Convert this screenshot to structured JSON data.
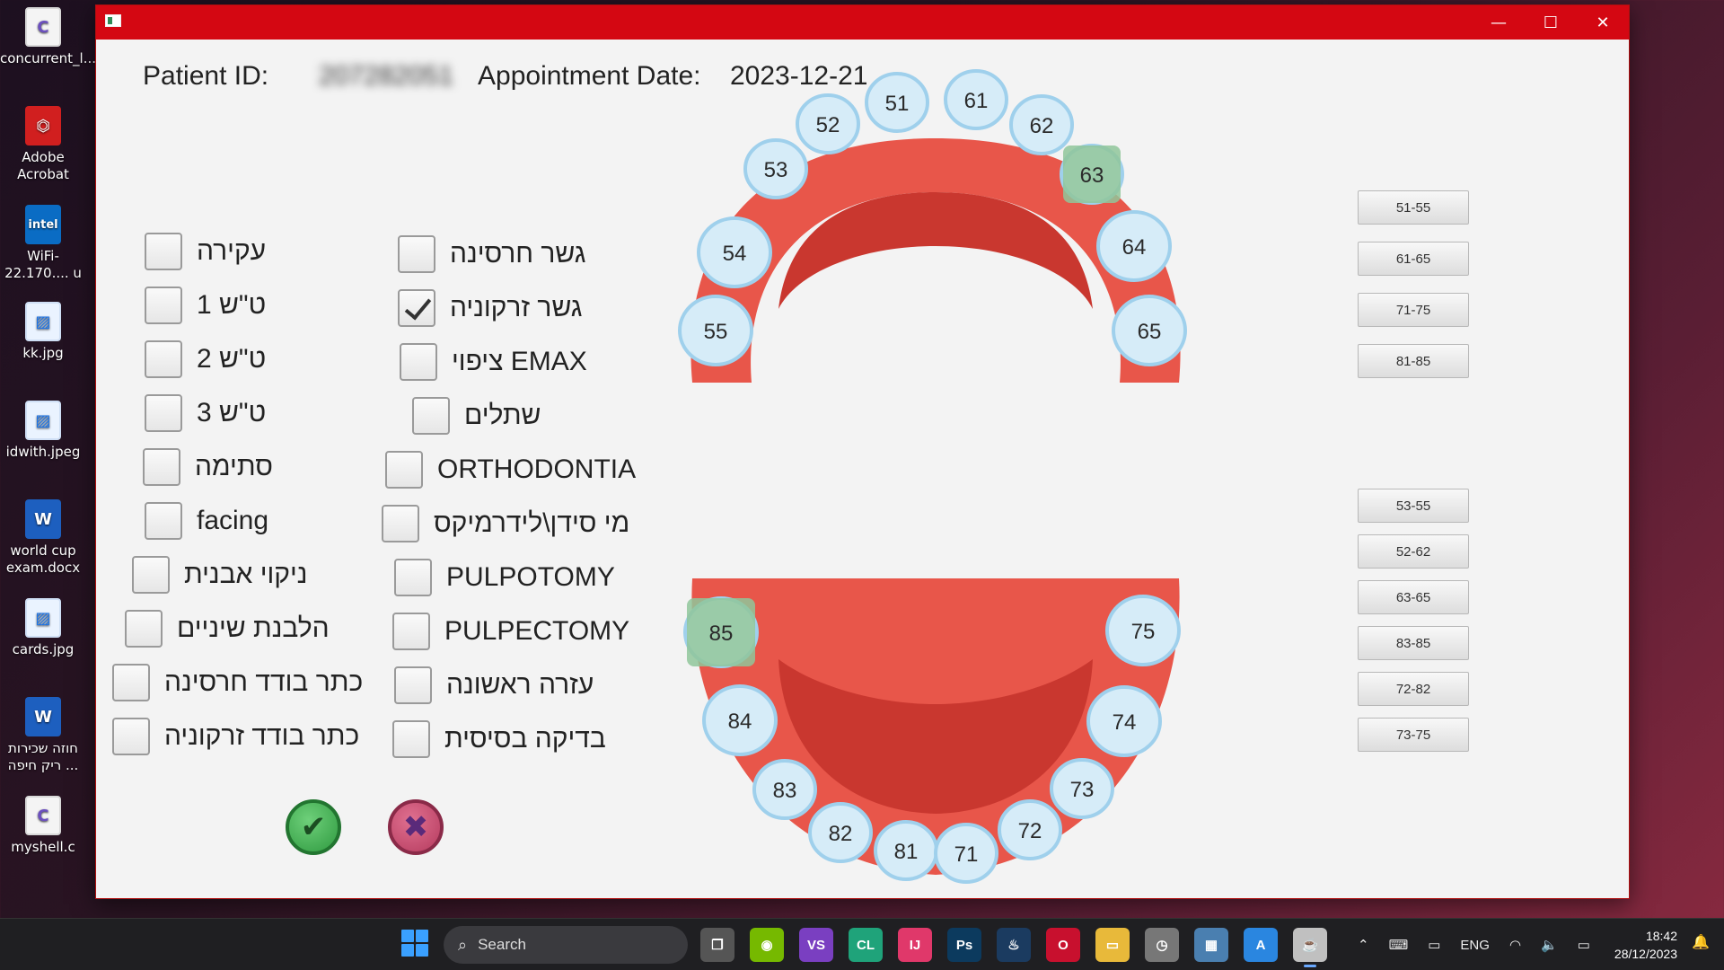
{
  "desktop": {
    "icons": [
      {
        "label": "concurrent_l...",
        "icon": "c-file-icon",
        "glyph": "C"
      },
      {
        "label": "Adobe Acrobat",
        "icon": "pdf-icon",
        "glyph": "⏣"
      },
      {
        "label": "WiFi-22.170.... u",
        "icon": "intel-icon",
        "glyph": "intel"
      },
      {
        "label": "kk.jpg",
        "icon": "image-icon",
        "glyph": "▨"
      },
      {
        "label": "idwith.jpeg",
        "icon": "image-icon",
        "glyph": "▨"
      },
      {
        "label": "world cup exam.docx",
        "icon": "word-icon",
        "glyph": "W"
      },
      {
        "label": "cards.jpg",
        "icon": "image-icon",
        "glyph": "▨"
      },
      {
        "label": "חוזה שכירות ריק חיפה ...",
        "icon": "word-icon",
        "glyph": "W"
      },
      {
        "label": "myshell.c",
        "icon": "c-file-icon",
        "glyph": "C"
      }
    ]
  },
  "window": {
    "controls": {
      "minimize": "—",
      "maximize": "☐",
      "close": "✕"
    },
    "header": {
      "patient_id_label": "Patient ID:",
      "patient_id_value": "207282051",
      "appointment_label": "Appointment Date:",
      "appointment_value": "2023-12-21"
    },
    "treatments_left": [
      {
        "label": "עקירה",
        "checked": false
      },
      {
        "label": "ט\"ש 1",
        "checked": false
      },
      {
        "label": "ט\"ש 2",
        "checked": false
      },
      {
        "label": "ט\"ש 3",
        "checked": false
      },
      {
        "label": "סתימה",
        "checked": false
      },
      {
        "label": "facing",
        "checked": false
      },
      {
        "label": "ניקוי אבנית",
        "checked": false
      },
      {
        "label": "הלבנת שיניים",
        "checked": false
      },
      {
        "label": "כתר בודד חרסינה",
        "checked": false
      },
      {
        "label": "כתר בודד זרקוניה",
        "checked": false
      }
    ],
    "treatments_right": [
      {
        "label": "גשר חרסינה",
        "checked": false
      },
      {
        "label": "גשר זרקוניה",
        "checked": true
      },
      {
        "label": "ציפוי EMAX",
        "checked": false
      },
      {
        "label": "שתלים",
        "checked": false
      },
      {
        "label": "ORTHODONTIA",
        "checked": false
      },
      {
        "label": "מי סידן\\לידרמיקס",
        "checked": false
      },
      {
        "label": "PULPOTOMY",
        "checked": false
      },
      {
        "label": "PULPECTOMY",
        "checked": false
      },
      {
        "label": "עזרה ראשונה",
        "checked": false
      },
      {
        "label": "בדיקה בסיסית",
        "checked": false
      }
    ],
    "actions": {
      "confirm_glyph": "✔",
      "cancel_glyph": "✖"
    },
    "upper_teeth": [
      {
        "num": "51",
        "selected": false
      },
      {
        "num": "61",
        "selected": false
      },
      {
        "num": "52",
        "selected": false
      },
      {
        "num": "62",
        "selected": false
      },
      {
        "num": "53",
        "selected": false
      },
      {
        "num": "63",
        "selected": true
      },
      {
        "num": "54",
        "selected": false
      },
      {
        "num": "64",
        "selected": false
      },
      {
        "num": "55",
        "selected": false
      },
      {
        "num": "65",
        "selected": false
      }
    ],
    "lower_teeth": [
      {
        "num": "85",
        "selected": true
      },
      {
        "num": "75",
        "selected": false
      },
      {
        "num": "84",
        "selected": false
      },
      {
        "num": "74",
        "selected": false
      },
      {
        "num": "83",
        "selected": false
      },
      {
        "num": "73",
        "selected": false
      },
      {
        "num": "82",
        "selected": false
      },
      {
        "num": "72",
        "selected": false
      },
      {
        "num": "81",
        "selected": false
      },
      {
        "num": "71",
        "selected": false
      }
    ],
    "range_buttons_upper": [
      "51-55",
      "61-65",
      "71-75",
      "81-85"
    ],
    "range_buttons_lower": [
      "53-55",
      "52-62",
      "63-65",
      "83-85",
      "72-82",
      "73-75"
    ],
    "colors": {
      "titlebar": "#d40712",
      "gum": "#e8564a",
      "gum_dark": "#c9372f",
      "tooth": "#d6ecf8",
      "tooth_edge": "#9fd0ec",
      "selected": "#8fc59a"
    }
  },
  "taskbar": {
    "search_placeholder": "Search",
    "apps": [
      {
        "name": "task-view-icon",
        "glyph": "❐",
        "color": "#555"
      },
      {
        "name": "nvidia-icon",
        "glyph": "◉",
        "color": "#76b900"
      },
      {
        "name": "visual-studio-icon",
        "glyph": "VS",
        "color": "#7a3fc1"
      },
      {
        "name": "clion-icon",
        "glyph": "CL",
        "color": "#1fa37a"
      },
      {
        "name": "intellij-icon",
        "glyph": "IJ",
        "color": "#e0386a"
      },
      {
        "name": "photoshop-icon",
        "glyph": "Ps",
        "color": "#0c3a5e"
      },
      {
        "name": "steam-icon",
        "glyph": "♨",
        "color": "#1b3b60"
      },
      {
        "name": "opera-icon",
        "glyph": "O",
        "color": "#c8102e"
      },
      {
        "name": "file-explorer-icon",
        "glyph": "▭",
        "color": "#e8b93a"
      },
      {
        "name": "clock-app-icon",
        "glyph": "◷",
        "color": "#777"
      },
      {
        "name": "monitor-app-icon",
        "glyph": "▦",
        "color": "#4a7fb0"
      },
      {
        "name": "app-store-icon",
        "glyph": "A",
        "color": "#2a86e0"
      },
      {
        "name": "java-icon",
        "glyph": "☕",
        "color": "#c0c0c0"
      }
    ],
    "tray": {
      "chevron": "⌃",
      "keyboard": "⌨",
      "display": "▭",
      "language": "ENG",
      "wifi": "◠",
      "volume": "🔈",
      "battery": "▭"
    },
    "time": "18:42",
    "date": "28/12/2023",
    "notification_glyph": "🔔"
  }
}
